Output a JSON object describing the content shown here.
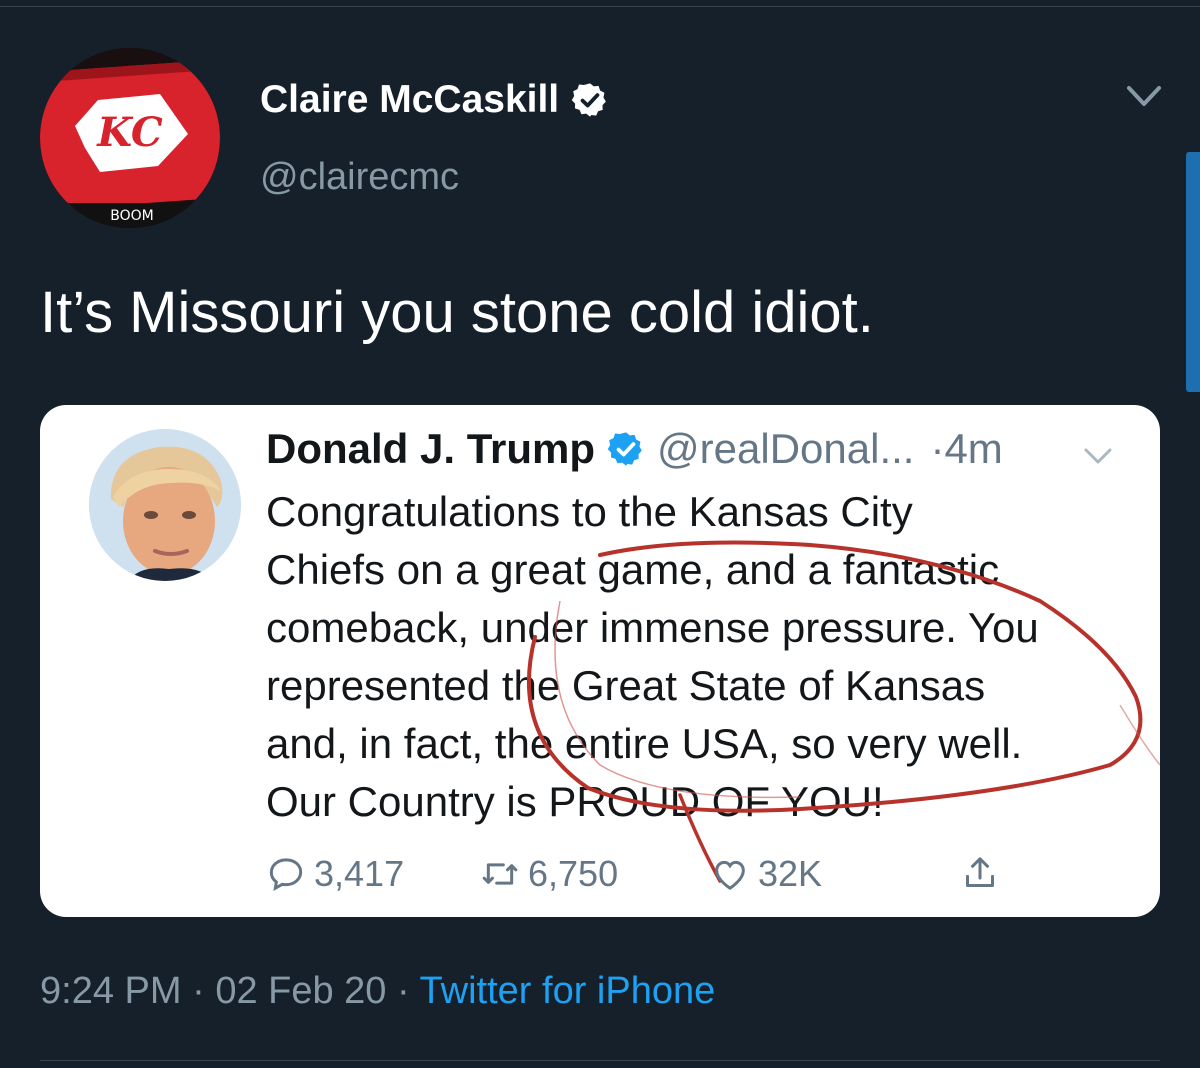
{
  "tweet": {
    "author_name": "Claire McCaskill",
    "author_handle": "@clairecmc",
    "avatar_badge_text": "BOOM",
    "avatar_logo_text": "KC",
    "text": "It’s Missouri you stone cold idiot.",
    "time": "9:24 PM",
    "date": "02 Feb 20",
    "separator": "·",
    "source": "Twitter for iPhone"
  },
  "quoted_tweet": {
    "author_name": "Donald J. Trump",
    "author_handle": "@realDonal...",
    "time": "·4m",
    "text_lines": [
      "Congratulations to the Kansas City",
      "Chiefs on a great game, and a fantastic",
      "comeback, under immense pressure. You",
      "represented the Great State of Kansas",
      "and, in fact, the entire USA, so very well.",
      "Our Country is PROUD OF YOU!"
    ],
    "replies": "3,417",
    "retweets": "6,750",
    "likes": "32K"
  },
  "icons": {
    "verified": "verified-badge-icon",
    "caret": "chevron-down-icon",
    "reply": "reply-icon",
    "retweet": "retweet-icon",
    "like": "heart-icon",
    "share": "share-icon"
  },
  "colors": {
    "background": "#15202b",
    "accent": "#1da1f2",
    "secondary_text": "#8899a6",
    "annotation_red": "#b8322c",
    "chiefs_red": "#e31837"
  }
}
